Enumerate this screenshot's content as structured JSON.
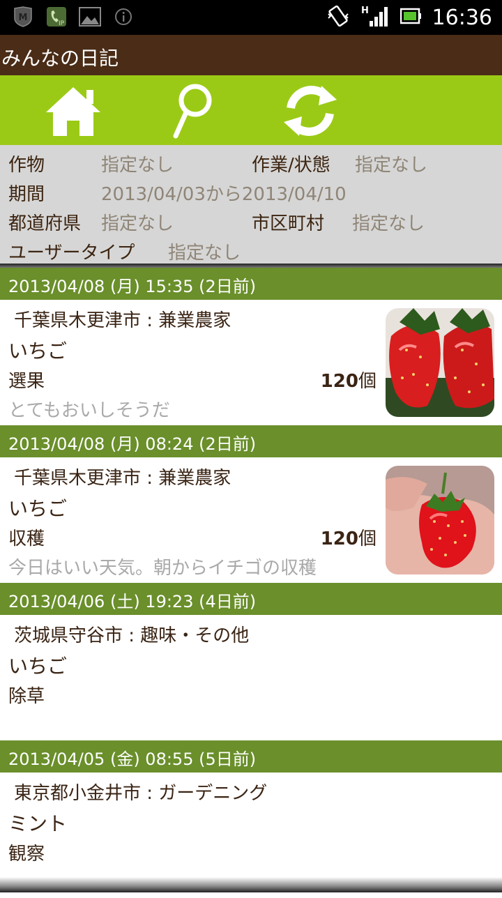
{
  "status_bar": {
    "time": "16:36",
    "left_icons": [
      "mcafee-shield-icon",
      "phone-ip-icon",
      "image-icon",
      "info-icon"
    ],
    "right_icons": [
      "vibrate-icon",
      "signal-icon",
      "battery-icon"
    ],
    "network_label": "H"
  },
  "app": {
    "title": "みんなの日記",
    "accent": "#9bca16",
    "header_color": "#4a2c17",
    "entry_header_color": "#6a8f2b"
  },
  "toolbar": {
    "buttons": [
      {
        "icon": "home-icon"
      },
      {
        "icon": "search-icon"
      },
      {
        "icon": "refresh-icon"
      }
    ]
  },
  "filters": {
    "crop_label": "作物",
    "crop_value": "指定なし",
    "work_label": "作業/状態",
    "work_value": "指定なし",
    "period_label": "期間",
    "period_value": "2013/04/03から2013/04/10",
    "prefecture_label": "都道府県",
    "prefecture_value": "指定なし",
    "city_label": "市区町村",
    "city_value": "指定なし",
    "usertype_label": "ユーザータイプ",
    "usertype_value": "指定なし"
  },
  "entries": [
    {
      "header": "2013/04/08 (月) 15:35 (2日前)",
      "location": "千葉県木更津市 : 兼業農家",
      "crop": "いちご",
      "work": "選果",
      "qty_num": "120",
      "qty_unit": "個",
      "comment": "とてもおいしそうだ",
      "photo": "strawberries-photo"
    },
    {
      "header": "2013/04/08 (月) 08:24 (2日前)",
      "location": "千葉県木更津市 : 兼業農家",
      "crop": "いちご",
      "work": "収穫",
      "qty_num": "120",
      "qty_unit": "個",
      "comment": "今日はいい天気。朝からイチゴの収穫",
      "photo": "strawberry-in-hand-photo"
    },
    {
      "header": "2013/04/06 (土) 19:23 (4日前)",
      "location": "茨城県守谷市 : 趣味・その他",
      "crop": "いちご",
      "work": "除草"
    },
    {
      "header": "2013/04/05 (金) 08:55 (5日前)",
      "location": "東京都小金井市 : ガーデニング",
      "crop": "ミント",
      "work": "観察"
    }
  ]
}
